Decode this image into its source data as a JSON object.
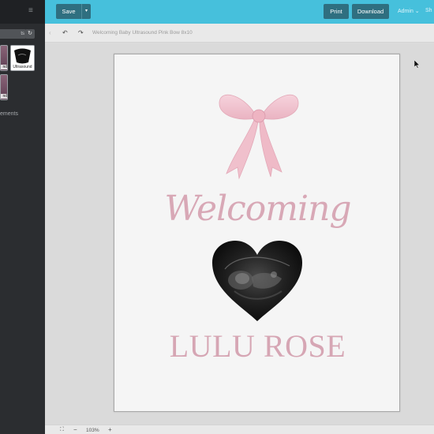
{
  "topbar": {
    "menu_icon": "hamburger-icon",
    "save_label": "Save",
    "save_dropdown_icon": "chevron-down-icon",
    "print_label": "Print",
    "download_label": "Download",
    "admin_label": "Admin ⌄",
    "share_label": "Sh"
  },
  "sidebar": {
    "search_text": "ts",
    "refresh_icon": "refresh-icon",
    "thumbnails": [
      {
        "label": "nd"
      },
      {
        "label": "Ultrasound"
      },
      {
        "label": "nd"
      }
    ],
    "elements_label": "ements"
  },
  "subbar": {
    "back_icon": "chevron-left-icon",
    "undo_icon": "undo-icon",
    "redo_icon": "redo-icon",
    "doc_title": "Welcoming Baby Ultrasound Pink Bow 8x10"
  },
  "design": {
    "heading": "Welcoming",
    "name": "LULU ROSE",
    "accent_color": "#d8a8b6",
    "bow_color": "#f2c4cf"
  },
  "bottombar": {
    "fit_icon": "fit-screen-icon",
    "zoom_out": "−",
    "zoom_level": "103%",
    "zoom_in": "+"
  },
  "colors": {
    "topbar": "#46c0dc",
    "button": "#2f6f80",
    "sidebar": "#2b2d30"
  }
}
